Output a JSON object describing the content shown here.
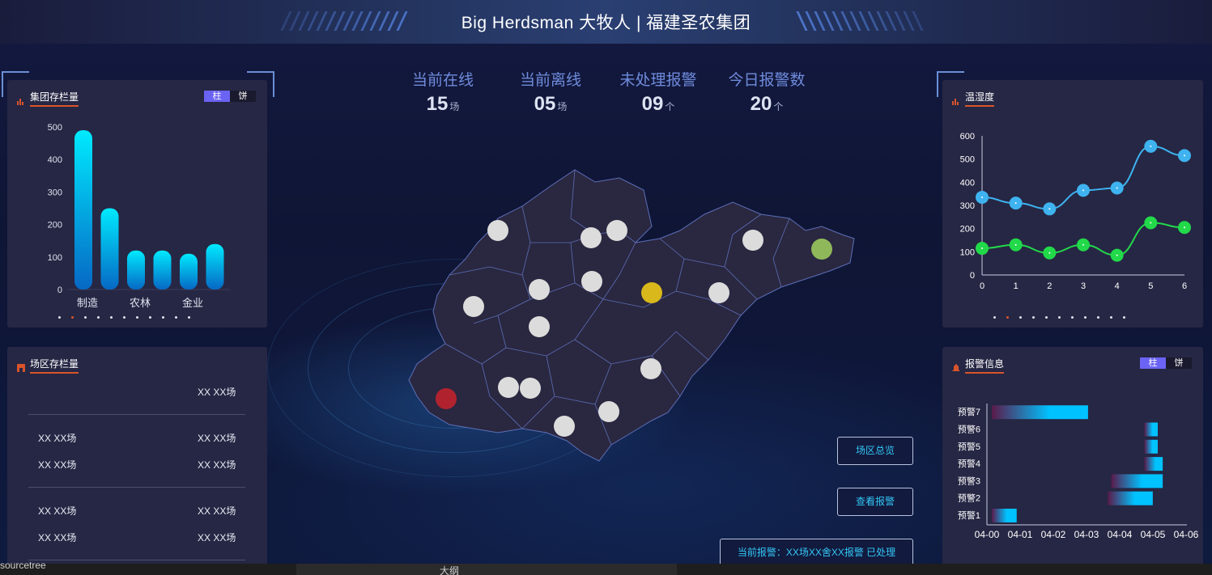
{
  "header": {
    "title": "Big Herdsman 大牧人 | 福建圣农集团"
  },
  "stats": [
    {
      "label": "当前在线",
      "value": "15",
      "unit": "场"
    },
    {
      "label": "当前离线",
      "value": "05",
      "unit": "场"
    },
    {
      "label": "未处理报警",
      "value": "09",
      "unit": "个"
    },
    {
      "label": "今日报警数",
      "value": "20",
      "unit": "个"
    }
  ],
  "left_top": {
    "title": "集团存栏量",
    "toggle": {
      "on": "柱",
      "off": "饼"
    },
    "chart_data": {
      "type": "bar",
      "categories": [
        "制造",
        "",
        "农林",
        "",
        "金业",
        ""
      ],
      "values": [
        490,
        250,
        120,
        120,
        110,
        140
      ],
      "yticks": [
        0,
        100,
        200,
        300,
        400,
        500
      ],
      "ylim": [
        0,
        500
      ],
      "colors": {
        "top": "#00eaff",
        "bottom": "#0668c4"
      }
    },
    "pager": {
      "count": 11,
      "active": 1
    }
  },
  "left_bottom": {
    "title": "场区存栏量",
    "rows": [
      {
        "c1": "",
        "c2": "XX XX场"
      },
      {
        "c1": "XX XX场",
        "c2": "XX XX场"
      },
      {
        "c1": "XX XX场",
        "c2": "XX XX场"
      },
      {
        "c1": "XX XX场",
        "c2": "XX XX场"
      },
      {
        "c1": "XX XX场",
        "c2": "XX XX场"
      }
    ]
  },
  "right_top": {
    "title": "温湿度",
    "chart_data": {
      "type": "line",
      "x": [
        0,
        1,
        2,
        3,
        4,
        5,
        6
      ],
      "series": [
        {
          "values": [
            335,
            310,
            285,
            365,
            375,
            555,
            515
          ],
          "color": "#3eb3f0"
        },
        {
          "values": [
            115,
            130,
            95,
            130,
            85,
            225,
            205
          ],
          "color": "#22d94a"
        }
      ],
      "yticks": [
        0,
        100,
        200,
        300,
        400,
        500,
        600
      ],
      "ylim": [
        0,
        600
      ]
    },
    "pager": {
      "count": 11,
      "active": 1
    }
  },
  "right_bottom": {
    "title": "报警信息",
    "toggle": {
      "on": "柱",
      "off": "饼"
    },
    "chart_data": {
      "type": "bar",
      "orientation": "horizontal",
      "categories": [
        "预警1",
        "预警2",
        "预警3",
        "预警4",
        "预警5",
        "预警6",
        "预警7"
      ],
      "ranges": [
        [
          0.0,
          0.75
        ],
        [
          3.5,
          4.85
        ],
        [
          3.6,
          5.15
        ],
        [
          4.6,
          5.15
        ],
        [
          4.6,
          5.0
        ],
        [
          4.6,
          5.0
        ],
        [
          0.0,
          2.9
        ]
      ],
      "xticks": [
        "04-00",
        "04-01",
        "04-02",
        "04-03",
        "04-04",
        "04-05",
        "04-06"
      ],
      "colors": {
        "start": "#5a1a4a",
        "end": "#00c2ff"
      }
    }
  },
  "buttons": {
    "overview": "场区总览",
    "alarms": "查看报警",
    "current_alarm": "当前报警：XX场XX舍XX报警 已处理"
  },
  "map": {
    "markers": [
      {
        "color": "#dcdcdc"
      },
      {
        "color": "#dcdcdc"
      },
      {
        "color": "#dcdcdc"
      },
      {
        "color": "#dcdcdc"
      },
      {
        "color": "#dcdcdc"
      },
      {
        "color": "#dcdcdc"
      },
      {
        "color": "#dcdcdc"
      },
      {
        "color": "#dcdcdc"
      },
      {
        "color": "#dcdcdc"
      },
      {
        "color": "#dcdcdc"
      },
      {
        "color": "#dcdcdc"
      },
      {
        "color": "#dcdcdc"
      },
      {
        "color": "#dcdcdc"
      },
      {
        "color": "#dcdcdc"
      },
      {
        "color": "#d9b81c"
      },
      {
        "color": "#8fb85a"
      },
      {
        "color": "#b0232e"
      }
    ]
  },
  "taskbar": {
    "left_text": "sourcetree",
    "right_text": "大纲"
  }
}
